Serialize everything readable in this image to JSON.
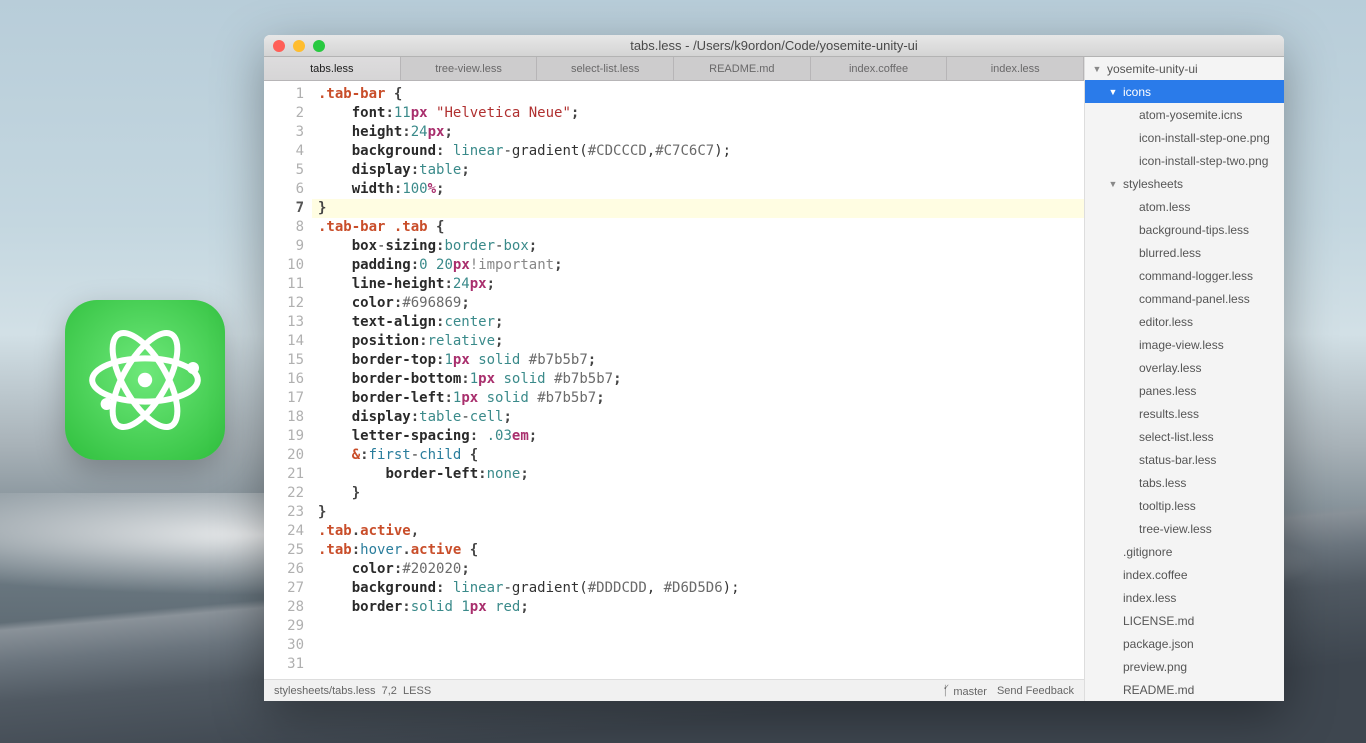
{
  "title": "tabs.less - /Users/k9ordon/Code/yosemite-unity-ui",
  "tabs": [
    {
      "label": "tabs.less",
      "active": true
    },
    {
      "label": "tree-view.less",
      "active": false
    },
    {
      "label": "select-list.less",
      "active": false
    },
    {
      "label": "README.md",
      "active": false
    },
    {
      "label": "index.coffee",
      "active": false
    },
    {
      "label": "index.less",
      "active": false
    }
  ],
  "code_lines": [
    {
      "n": 1,
      "tokens": [
        [
          "sel",
          ".tab-bar"
        ],
        [
          "",
          ""
        ],
        [
          "punc",
          " {"
        ]
      ]
    },
    {
      "n": 2,
      "tokens": [
        [
          "",
          "    "
        ],
        [
          "prop",
          "font"
        ],
        [
          "punc",
          ":"
        ],
        [
          "num",
          "11"
        ],
        [
          "unit",
          "px"
        ],
        [
          "",
          " "
        ],
        [
          "str",
          "\"Helvetica Neue\""
        ],
        [
          "punc",
          ";"
        ]
      ]
    },
    {
      "n": 3,
      "tokens": [
        [
          "",
          "    "
        ],
        [
          "prop",
          "height"
        ],
        [
          "punc",
          ":"
        ],
        [
          "num",
          "24"
        ],
        [
          "unit",
          "px"
        ],
        [
          "punc",
          ";"
        ]
      ]
    },
    {
      "n": 4,
      "tokens": [
        [
          "",
          "    "
        ],
        [
          "prop",
          "background"
        ],
        [
          "punc",
          ": "
        ],
        [
          "kw",
          "linear"
        ],
        [
          "",
          "-gradient("
        ],
        [
          "hex",
          "#CDCCCD"
        ],
        [
          "",
          ","
        ],
        [
          "hex",
          "#C7C6C7"
        ],
        [
          "",
          ");"
        ]
      ]
    },
    {
      "n": 5,
      "tokens": [
        [
          "",
          "    "
        ],
        [
          "prop",
          "display"
        ],
        [
          "punc",
          ":"
        ],
        [
          "kw",
          "table"
        ],
        [
          "punc",
          ";"
        ]
      ]
    },
    {
      "n": 6,
      "tokens": [
        [
          "",
          "    "
        ],
        [
          "prop",
          "width"
        ],
        [
          "punc",
          ":"
        ],
        [
          "num",
          "100"
        ],
        [
          "unit",
          "%"
        ],
        [
          "punc",
          ";"
        ]
      ]
    },
    {
      "n": 7,
      "tokens": [
        [
          "punc",
          "}"
        ]
      ],
      "current": true
    },
    {
      "n": 8,
      "tokens": []
    },
    {
      "n": 9,
      "tokens": [
        [
          "sel",
          ".tab-bar"
        ],
        [
          "",
          " "
        ],
        [
          "sel",
          ".tab"
        ],
        [
          "punc",
          " {"
        ]
      ]
    },
    {
      "n": 10,
      "tokens": [
        [
          "",
          "    "
        ],
        [
          "prop",
          "box"
        ],
        [
          "",
          "-"
        ],
        [
          "prop",
          "sizing"
        ],
        [
          "punc",
          ":"
        ],
        [
          "kw",
          "border"
        ],
        [
          "",
          "-"
        ],
        [
          "kw",
          "box"
        ],
        [
          "punc",
          ";"
        ]
      ]
    },
    {
      "n": 11,
      "tokens": [
        [
          "",
          "    "
        ],
        [
          "prop",
          "padding"
        ],
        [
          "punc",
          ":"
        ],
        [
          "num",
          "0"
        ],
        [
          "",
          " "
        ],
        [
          "num",
          "20"
        ],
        [
          "unit",
          "px"
        ],
        [
          "imp",
          "!important"
        ],
        [
          "punc",
          ";"
        ]
      ]
    },
    {
      "n": 12,
      "tokens": [
        [
          "",
          "    "
        ],
        [
          "prop",
          "line-height"
        ],
        [
          "punc",
          ":"
        ],
        [
          "num",
          "24"
        ],
        [
          "unit",
          "px"
        ],
        [
          "punc",
          ";"
        ]
      ]
    },
    {
      "n": 13,
      "tokens": [
        [
          "",
          "    "
        ],
        [
          "prop",
          "color"
        ],
        [
          "punc",
          ":"
        ],
        [
          "hex",
          "#696869"
        ],
        [
          "punc",
          ";"
        ]
      ]
    },
    {
      "n": 14,
      "tokens": [
        [
          "",
          "    "
        ],
        [
          "prop",
          "text-align"
        ],
        [
          "punc",
          ":"
        ],
        [
          "kw",
          "center"
        ],
        [
          "punc",
          ";"
        ]
      ]
    },
    {
      "n": 15,
      "tokens": [
        [
          "",
          "    "
        ],
        [
          "prop",
          "position"
        ],
        [
          "punc",
          ":"
        ],
        [
          "kw",
          "relative"
        ],
        [
          "punc",
          ";"
        ]
      ]
    },
    {
      "n": 16,
      "tokens": [
        [
          "",
          "    "
        ],
        [
          "prop",
          "border-top"
        ],
        [
          "punc",
          ":"
        ],
        [
          "num",
          "1"
        ],
        [
          "unit",
          "px"
        ],
        [
          "",
          " "
        ],
        [
          "kw",
          "solid"
        ],
        [
          "",
          " "
        ],
        [
          "hex",
          "#b7b5b7"
        ],
        [
          "punc",
          ";"
        ]
      ]
    },
    {
      "n": 17,
      "tokens": [
        [
          "",
          "    "
        ],
        [
          "prop",
          "border-bottom"
        ],
        [
          "punc",
          ":"
        ],
        [
          "num",
          "1"
        ],
        [
          "unit",
          "px"
        ],
        [
          "",
          " "
        ],
        [
          "kw",
          "solid"
        ],
        [
          "",
          " "
        ],
        [
          "hex",
          "#b7b5b7"
        ],
        [
          "punc",
          ";"
        ]
      ]
    },
    {
      "n": 18,
      "tokens": [
        [
          "",
          "    "
        ],
        [
          "prop",
          "border-left"
        ],
        [
          "punc",
          ":"
        ],
        [
          "num",
          "1"
        ],
        [
          "unit",
          "px"
        ],
        [
          "",
          " "
        ],
        [
          "kw",
          "solid"
        ],
        [
          "",
          " "
        ],
        [
          "hex",
          "#b7b5b7"
        ],
        [
          "punc",
          ";"
        ]
      ]
    },
    {
      "n": 19,
      "tokens": [
        [
          "",
          "    "
        ],
        [
          "prop",
          "display"
        ],
        [
          "punc",
          ":"
        ],
        [
          "kw",
          "table"
        ],
        [
          "",
          "-"
        ],
        [
          "kw",
          "cell"
        ],
        [
          "punc",
          ";"
        ]
      ]
    },
    {
      "n": 20,
      "tokens": [
        [
          "",
          "    "
        ],
        [
          "prop",
          "letter-spacing"
        ],
        [
          "punc",
          ": "
        ],
        [
          "num",
          ".03"
        ],
        [
          "unit",
          "em"
        ],
        [
          "punc",
          ";"
        ]
      ]
    },
    {
      "n": 21,
      "tokens": []
    },
    {
      "n": 22,
      "tokens": [
        [
          "",
          "    "
        ],
        [
          "sel",
          "&"
        ],
        [
          "punc",
          ":"
        ],
        [
          "pseudo",
          "first"
        ],
        [
          "",
          "-"
        ],
        [
          "pseudo",
          "child"
        ],
        [
          "punc",
          " {"
        ]
      ]
    },
    {
      "n": 23,
      "tokens": [
        [
          "",
          "        "
        ],
        [
          "prop",
          "border-left"
        ],
        [
          "punc",
          ":"
        ],
        [
          "kw",
          "none"
        ],
        [
          "punc",
          ";"
        ]
      ]
    },
    {
      "n": 24,
      "tokens": [
        [
          "",
          "    "
        ],
        [
          "punc",
          "}"
        ]
      ]
    },
    {
      "n": 25,
      "tokens": [
        [
          "punc",
          "}"
        ]
      ]
    },
    {
      "n": 26,
      "tokens": []
    },
    {
      "n": 27,
      "tokens": [
        [
          "sel",
          ".tab"
        ],
        [
          "punc",
          "."
        ],
        [
          "sel",
          "active"
        ],
        [
          "punc",
          ","
        ]
      ]
    },
    {
      "n": 28,
      "tokens": [
        [
          "sel",
          ".tab"
        ],
        [
          "punc",
          ":"
        ],
        [
          "pseudo",
          "hover"
        ],
        [
          "punc",
          "."
        ],
        [
          "sel",
          "active"
        ],
        [
          "punc",
          " {"
        ]
      ]
    },
    {
      "n": 29,
      "tokens": [
        [
          "",
          "    "
        ],
        [
          "prop",
          "color"
        ],
        [
          "punc",
          ":"
        ],
        [
          "hex",
          "#202020"
        ],
        [
          "punc",
          ";"
        ]
      ]
    },
    {
      "n": 30,
      "tokens": [
        [
          "",
          "    "
        ],
        [
          "prop",
          "background"
        ],
        [
          "punc",
          ": "
        ],
        [
          "kw",
          "linear"
        ],
        [
          "",
          "-gradient("
        ],
        [
          "hex",
          "#DDDCDD"
        ],
        [
          "",
          ", "
        ],
        [
          "hex",
          "#D6D5D6"
        ],
        [
          "",
          ");"
        ]
      ]
    },
    {
      "n": 31,
      "tokens": [
        [
          "",
          "    "
        ],
        [
          "prop",
          "border"
        ],
        [
          "punc",
          ":"
        ],
        [
          "kw",
          "solid"
        ],
        [
          "",
          " "
        ],
        [
          "num",
          "1"
        ],
        [
          "unit",
          "px"
        ],
        [
          "",
          " "
        ],
        [
          "kw",
          "red"
        ],
        [
          "punc",
          ";"
        ]
      ]
    }
  ],
  "tree": [
    {
      "label": "yosemite-unity-ui",
      "depth": 0,
      "expanded": true,
      "folder": true
    },
    {
      "label": "icons",
      "depth": 1,
      "expanded": true,
      "folder": true,
      "selected": true
    },
    {
      "label": "atom-yosemite.icns",
      "depth": 2
    },
    {
      "label": "icon-install-step-one.png",
      "depth": 2
    },
    {
      "label": "icon-install-step-two.png",
      "depth": 2
    },
    {
      "label": "stylesheets",
      "depth": 1,
      "expanded": true,
      "folder": true
    },
    {
      "label": "atom.less",
      "depth": 2
    },
    {
      "label": "background-tips.less",
      "depth": 2
    },
    {
      "label": "blurred.less",
      "depth": 2
    },
    {
      "label": "command-logger.less",
      "depth": 2
    },
    {
      "label": "command-panel.less",
      "depth": 2
    },
    {
      "label": "editor.less",
      "depth": 2
    },
    {
      "label": "image-view.less",
      "depth": 2
    },
    {
      "label": "overlay.less",
      "depth": 2
    },
    {
      "label": "panes.less",
      "depth": 2
    },
    {
      "label": "results.less",
      "depth": 2
    },
    {
      "label": "select-list.less",
      "depth": 2
    },
    {
      "label": "status-bar.less",
      "depth": 2
    },
    {
      "label": "tabs.less",
      "depth": 2
    },
    {
      "label": "tooltip.less",
      "depth": 2
    },
    {
      "label": "tree-view.less",
      "depth": 2
    },
    {
      "label": ".gitignore",
      "depth": 1
    },
    {
      "label": "index.coffee",
      "depth": 1
    },
    {
      "label": "index.less",
      "depth": 1
    },
    {
      "label": "LICENSE.md",
      "depth": 1
    },
    {
      "label": "package.json",
      "depth": 1
    },
    {
      "label": "preview.png",
      "depth": 1
    },
    {
      "label": "README.md",
      "depth": 1
    }
  ],
  "status": {
    "path": "stylesheets/tabs.less",
    "cursor": "7,2",
    "grammar": "LESS",
    "branch": "master",
    "feedback": "Send Feedback"
  }
}
